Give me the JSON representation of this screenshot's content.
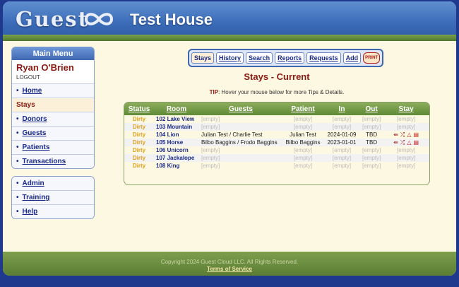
{
  "header": {
    "logo_text": "Guest",
    "house_name": "Test House"
  },
  "sidebar": {
    "menu_title": "Main Menu",
    "user_name": "Ryan O'Brien",
    "logout_label": "LOGOUT",
    "items": [
      {
        "label": "Home",
        "current": false
      },
      {
        "label": "Stays",
        "current": true
      },
      {
        "label": "Donors",
        "current": false
      },
      {
        "label": "Guests",
        "current": false
      },
      {
        "label": "Patients",
        "current": false
      },
      {
        "label": "Transactions",
        "current": false
      }
    ],
    "secondary_items": [
      {
        "label": "Admin"
      },
      {
        "label": "Training"
      },
      {
        "label": "Help"
      }
    ]
  },
  "topnav": {
    "stays": "Stays",
    "history": "History",
    "search": "Search",
    "reports": "Reports",
    "requests": "Requests",
    "add": "Add",
    "print": "PRINT"
  },
  "main": {
    "title": "Stays - Current",
    "tip_label": "TIP",
    "tip_text": ": Hover your mouse below for more Tips & Details."
  },
  "table": {
    "headers": [
      "Status",
      "Room",
      "Guests",
      "Patient",
      "In",
      "Out",
      "Stay"
    ],
    "rows": [
      {
        "status": "Dirty",
        "room": "102 Lake View",
        "guests": "[empty]",
        "patient": "[empty]",
        "in": "[empty]",
        "out": "[empty]",
        "stay": "[empty]"
      },
      {
        "status": "Dirty",
        "room": "103 Mountain",
        "guests": "[empty]",
        "patient": "[empty]",
        "in": "[empty]",
        "out": "[empty]",
        "stay": "[empty]"
      },
      {
        "status": "Dirty",
        "room": "104 Lion",
        "guests": "Julian Test / Charlie Test",
        "patient": "Julian Test",
        "in": "2024-01-09",
        "out": "TBD",
        "stay": ""
      },
      {
        "status": "Dirty",
        "room": "105 Horse",
        "guests": "Bilbo Baggins / Frodo Baggins",
        "patient": "Bilbo Baggins",
        "in": "2023-01-01",
        "out": "TBD",
        "stay": ""
      },
      {
        "status": "Dirty",
        "room": "106 Unicorn",
        "guests": "[empty]",
        "patient": "[empty]",
        "in": "[empty]",
        "out": "[empty]",
        "stay": "[empty]"
      },
      {
        "status": "Dirty",
        "room": "107 Jackalope",
        "guests": "[empty]",
        "patient": "[empty]",
        "in": "[empty]",
        "out": "[empty]",
        "stay": "[empty]"
      },
      {
        "status": "Dirty",
        "room": "108 King",
        "guests": "[empty]",
        "patient": "[empty]",
        "in": "[empty]",
        "out": "[empty]",
        "stay": "[empty]"
      }
    ],
    "stay_icon_names": [
      "checkout-arrow-icon",
      "move-shuffle-icon",
      "warning-triangle-icon",
      "document-icon"
    ]
  },
  "footer": {
    "copyright": "Copyright 2024 Guest Cloud LLC. All Rights Reserved.",
    "terms": "Terms of Service"
  },
  "colors": {
    "header_blue": "#3d6db8",
    "accent_red": "#8a1a12",
    "status_dirty": "#e0a020",
    "grass_green": "#5f8a37",
    "page_bg": "#fdf8e1"
  }
}
